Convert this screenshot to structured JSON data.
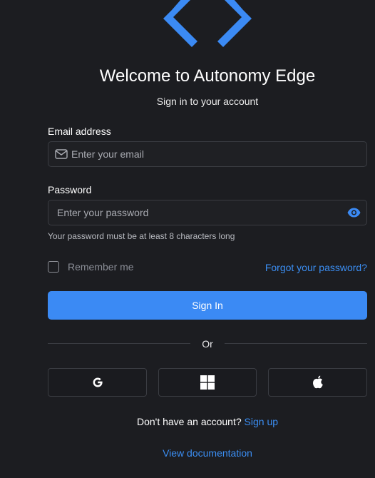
{
  "brand": {
    "logo_icon": "autonomy-edge-logo-icon",
    "accent_color": "#3b8af4"
  },
  "header": {
    "title": "Welcome to Autonomy Edge",
    "subtitle": "Sign in to your account"
  },
  "form": {
    "email": {
      "label": "Email address",
      "placeholder": "Enter your email",
      "icon": "mail-icon"
    },
    "password": {
      "label": "Password",
      "placeholder": "Enter your password",
      "toggle_icon": "eye-icon",
      "hint": "Your password must be at least 8 characters long"
    },
    "remember_me": {
      "label": "Remember me",
      "checked": false
    },
    "forgot_password": "Forgot your password?",
    "submit_label": "Sign In"
  },
  "divider_text": "Or",
  "social_buttons": [
    {
      "name": "google",
      "icon": "google-icon"
    },
    {
      "name": "microsoft",
      "icon": "microsoft-icon"
    },
    {
      "name": "apple",
      "icon": "apple-icon"
    }
  ],
  "footer": {
    "signup_prompt": "Don't have an account?",
    "signup_link": "Sign up",
    "docs_link": "View documentation"
  }
}
